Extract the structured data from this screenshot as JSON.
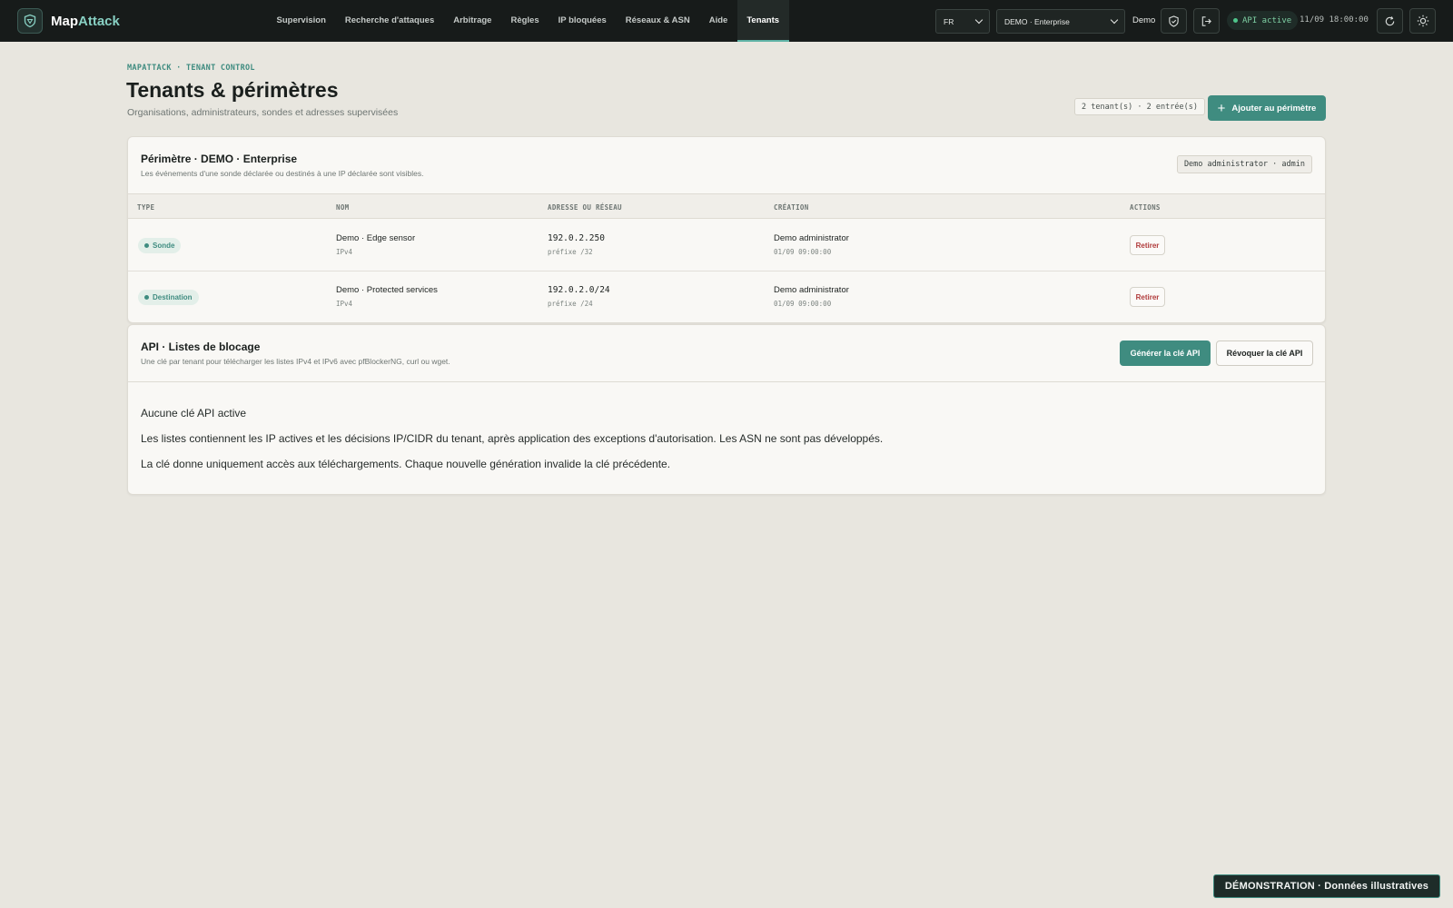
{
  "app": {
    "name_part1": "Map",
    "name_part2": "Attack"
  },
  "nav": {
    "items": [
      {
        "label": "Supervision"
      },
      {
        "label": "Recherche d'attaques"
      },
      {
        "label": "Arbitrage"
      },
      {
        "label": "Règles"
      },
      {
        "label": "IP bloquées"
      },
      {
        "label": "Réseaux & ASN"
      },
      {
        "label": "Aide"
      },
      {
        "label": "Tenants"
      }
    ],
    "active": "Tenants"
  },
  "topbar": {
    "language": "FR",
    "tenant_select": "DEMO · Enterprise",
    "user": "Demo",
    "api_status": "API active",
    "datetime": "11/09 18:00:00"
  },
  "header": {
    "eyebrow": "MAPATTACK · TENANT CONTROL",
    "title": "Tenants & périmètres",
    "subtitle": "Organisations, administrateurs, sondes et adresses supervisées",
    "count_chip": "2 tenant(s) · 2 entrée(s)",
    "add_button": "Ajouter au périmètre"
  },
  "perimeter": {
    "title": "Périmètre · DEMO · Enterprise",
    "description": "Les événements d'une sonde déclarée ou destinés à une IP déclarée sont visibles.",
    "admin_chip": "Demo administrator · admin",
    "columns": [
      "TYPE",
      "NOM",
      "ADRESSE OU RÉSEAU",
      "CRÉATION",
      "ACTIONS"
    ],
    "rows": [
      {
        "type": "Sonde",
        "name": "Demo · Edge sensor",
        "family": "IPv4",
        "address": "192.0.2.250",
        "prefix": "préfixe /32",
        "created_by": "Demo administrator",
        "created_at": "01/09 09:00:00",
        "action": "Retirer"
      },
      {
        "type": "Destination",
        "name": "Demo · Protected services",
        "family": "IPv4",
        "address": "192.0.2.0/24",
        "prefix": "préfixe /24",
        "created_by": "Demo administrator",
        "created_at": "01/09 09:00:00",
        "action": "Retirer"
      }
    ]
  },
  "api": {
    "title": "API · Listes de blocage",
    "description": "Une clé par tenant pour télécharger les listes IPv4 et IPv6 avec pfBlockerNG, curl ou wget.",
    "generate_button": "Générer la clé API",
    "revoke_button": "Révoquer la clé API",
    "status": "Aucune clé API active",
    "paragraph1": "Les listes contiennent les IP actives et les décisions IP/CIDR du tenant, après application des exceptions d'autorisation. Les ASN ne sont pas développés.",
    "paragraph2": "La clé donne uniquement accès aux téléchargements. Chaque nouvelle génération invalide la clé précédente."
  },
  "banner": "DÉMONSTRATION · Données illustratives",
  "colors": {
    "accent": "#3f8c80",
    "topbar": "#171b1a",
    "background": "#e8e6df",
    "danger": "#b03a3a",
    "api_ok": "#4fc58b"
  }
}
